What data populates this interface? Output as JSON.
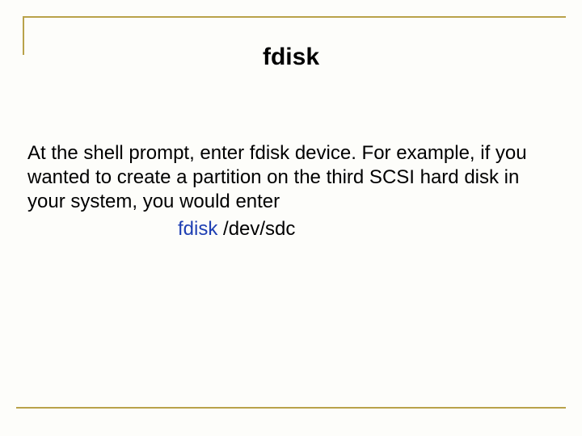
{
  "title": "fdisk",
  "body_text": "At the shell prompt, enter fdisk device. For example, if you wanted to create a partition on the third SCSI hard disk in your system, you would enter",
  "command": "fdisk",
  "command_arg": " /dev/sdc"
}
